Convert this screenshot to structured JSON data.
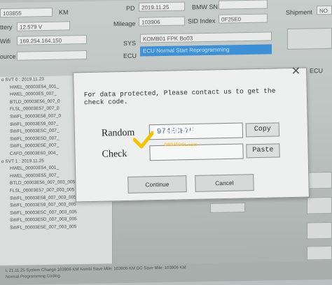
{
  "top_left": {
    "field1": "103855",
    "field1_unit": "KM",
    "battery_label": "ttery",
    "battery_value": "12.579 V",
    "wifi_label": "Wifi",
    "wifi_value": "169.254.164.150",
    "source_label": "ource"
  },
  "top_mid": {
    "pd_label": "PD",
    "pd_value": "2019.11.25",
    "mileage_label": "Mileage",
    "mileage_value": "103906",
    "bmw_sn_label": "BMW SN",
    "sid_index_label": "SID Index",
    "sid_index_value": "0F25E0",
    "sys_label": "SYS",
    "sys_value": "KOMB01 FPK Bo03",
    "ecu_label": "ECU",
    "ecu_value": "ECU Normal Start Reprogramming",
    "shipment_label": "Shipment",
    "shipment_value": "NO",
    "ecu_right_label": "ECU"
  },
  "tree": {
    "items": [
      "o SVT 0 : 2019.11.23",
      "HWEL_00003E54_001_",
      "HWEL_00003E5_007_",
      "BTLD_00003E56_007_0",
      "FLSL_00003E57_007_0",
      "SWFL_00003E58_007_0",
      "SWFL_00003E59_007_",
      "SWFL_00003E5C_007_",
      "SWFL_00003E5D_007_",
      "SWFL_00003E5E_007_",
      "CAFD_00003E60_004_",
      "o SVT 1 : 2019.11.25",
      "HWEL_00003E54_001_",
      "HWEL_00003E55_007_",
      "BTLD_00003E56_007_003_005",
      "FLSL_00003E57_007_003_005",
      "SWFL_00003E58_007_003_005",
      "SWFL_00003E59_007_003_005",
      "SWFL_00003E5C_007_003_005",
      "SWFL_00003E5D_007_003_005",
      "SWFL_00003E5E_007_003_005"
    ]
  },
  "status": {
    "line1": "L 21.11.25 System Change    103906 KM   Kombi Save Mile: 103906 KM   DC Save Mile: 103906 KM",
    "line2": "   Normal Programming  Coding"
  },
  "dialog": {
    "message": "For data protected, Please contact us to get the check code.",
    "random_label": "Random",
    "random_value": "974ECB7F",
    "check_label": "Check",
    "check_value": "",
    "copy_label": "Copy",
    "paste_label": "Paste",
    "continue_label": "Continue",
    "cancel_label": "Cancel",
    "close_glyph": "✕"
  },
  "watermark": {
    "text": "OBD2",
    "subtext": "OBD2TOOL.com"
  }
}
